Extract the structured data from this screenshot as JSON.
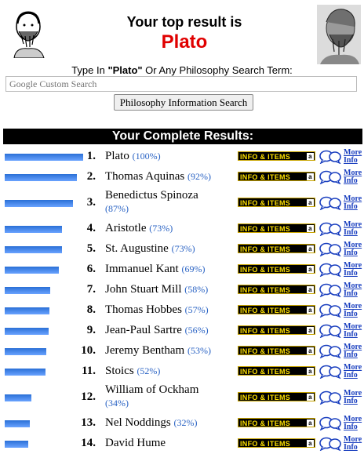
{
  "header": {
    "title": "Your top result is",
    "top_result": "Plato"
  },
  "search": {
    "prompt_before": "Type In ",
    "prompt_term": "\"Plato\"",
    "prompt_after": " Or Any Philosophy Search Term:",
    "placeholder": "Google Custom Search",
    "button_label": "Philosophy Information Search"
  },
  "results_header": "Your Complete Results:",
  "info_label": "INFO & ITEMS",
  "amazon_glyph": "a",
  "more_label_1": "More",
  "more_label_2": "Info",
  "results": [
    {
      "rank": "1.",
      "name": "Plato",
      "pct": "(100%)",
      "value": 100
    },
    {
      "rank": "2.",
      "name": "Thomas Aquinas",
      "pct": "(92%)",
      "value": 92
    },
    {
      "rank": "3.",
      "name": "Benedictus Spinoza",
      "pct": "(87%)",
      "value": 87
    },
    {
      "rank": "4.",
      "name": "Aristotle",
      "pct": "(73%)",
      "value": 73
    },
    {
      "rank": "5.",
      "name": "St. Augustine",
      "pct": "(73%)",
      "value": 73
    },
    {
      "rank": "6.",
      "name": "Immanuel Kant",
      "pct": "(69%)",
      "value": 69
    },
    {
      "rank": "7.",
      "name": "John Stuart Mill",
      "pct": "(58%)",
      "value": 58
    },
    {
      "rank": "8.",
      "name": "Thomas Hobbes",
      "pct": "(57%)",
      "value": 57
    },
    {
      "rank": "9.",
      "name": "Jean-Paul Sartre",
      "pct": "(56%)",
      "value": 56
    },
    {
      "rank": "10.",
      "name": "Jeremy Bentham",
      "pct": "(53%)",
      "value": 53
    },
    {
      "rank": "11.",
      "name": "Stoics",
      "pct": "(52%)",
      "value": 52
    },
    {
      "rank": "12.",
      "name": "William of Ockham",
      "pct": "(34%)",
      "value": 34
    },
    {
      "rank": "13.",
      "name": "Nel Noddings",
      "pct": "(32%)",
      "value": 32
    },
    {
      "rank": "14.",
      "name": "David Hume",
      "pct": "",
      "value": 30
    }
  ]
}
